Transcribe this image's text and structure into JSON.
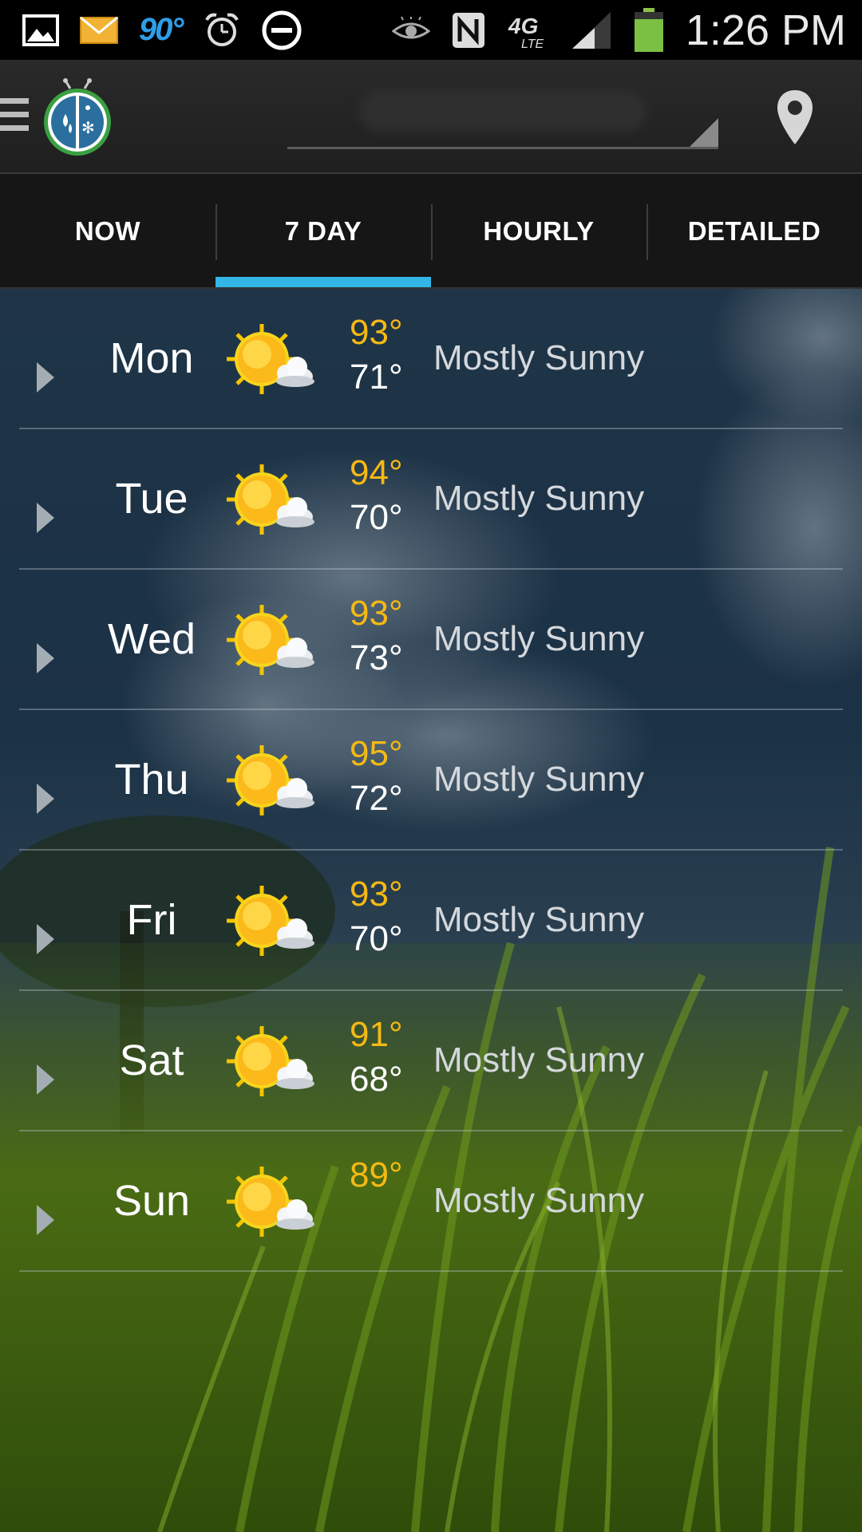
{
  "status_bar": {
    "icons": [
      "gallery-icon",
      "email-icon",
      "weather-temp-icon",
      "alarm-icon",
      "do-not-disturb-icon",
      "eye-icon",
      "nfc-icon",
      "4g-lte-icon",
      "signal-icon",
      "battery-icon"
    ],
    "temp": "90°",
    "time": "1:26 PM"
  },
  "app_bar": {
    "menu_icon": "menu-icon",
    "logo_icon": "weatherbug-logo-icon",
    "location_value": "",
    "location_icon": "location-pin-icon"
  },
  "tabs": [
    {
      "label": "NOW",
      "active": false
    },
    {
      "label": "7 DAY",
      "active": true
    },
    {
      "label": "HOURLY",
      "active": false
    },
    {
      "label": "DETAILED",
      "active": false
    }
  ],
  "forecast": [
    {
      "day": "Mon",
      "hi": "93°",
      "lo": "71°",
      "condition": "Mostly Sunny",
      "icon": "mostly-sunny-icon"
    },
    {
      "day": "Tue",
      "hi": "94°",
      "lo": "70°",
      "condition": "Mostly Sunny",
      "icon": "mostly-sunny-icon"
    },
    {
      "day": "Wed",
      "hi": "93°",
      "lo": "73°",
      "condition": "Mostly Sunny",
      "icon": "mostly-sunny-icon"
    },
    {
      "day": "Thu",
      "hi": "95°",
      "lo": "72°",
      "condition": "Mostly Sunny",
      "icon": "mostly-sunny-icon"
    },
    {
      "day": "Fri",
      "hi": "93°",
      "lo": "70°",
      "condition": "Mostly Sunny",
      "icon": "mostly-sunny-icon"
    },
    {
      "day": "Sat",
      "hi": "91°",
      "lo": "68°",
      "condition": "Mostly Sunny",
      "icon": "mostly-sunny-icon"
    },
    {
      "day": "Sun",
      "hi": "89°",
      "lo": "",
      "condition": "Mostly Sunny",
      "icon": "mostly-sunny-icon"
    }
  ],
  "colors": {
    "accent": "#33b5e5",
    "hi_temp": "#f5b914",
    "status_temp": "#2f9ee8",
    "battery": "#7bc043"
  }
}
